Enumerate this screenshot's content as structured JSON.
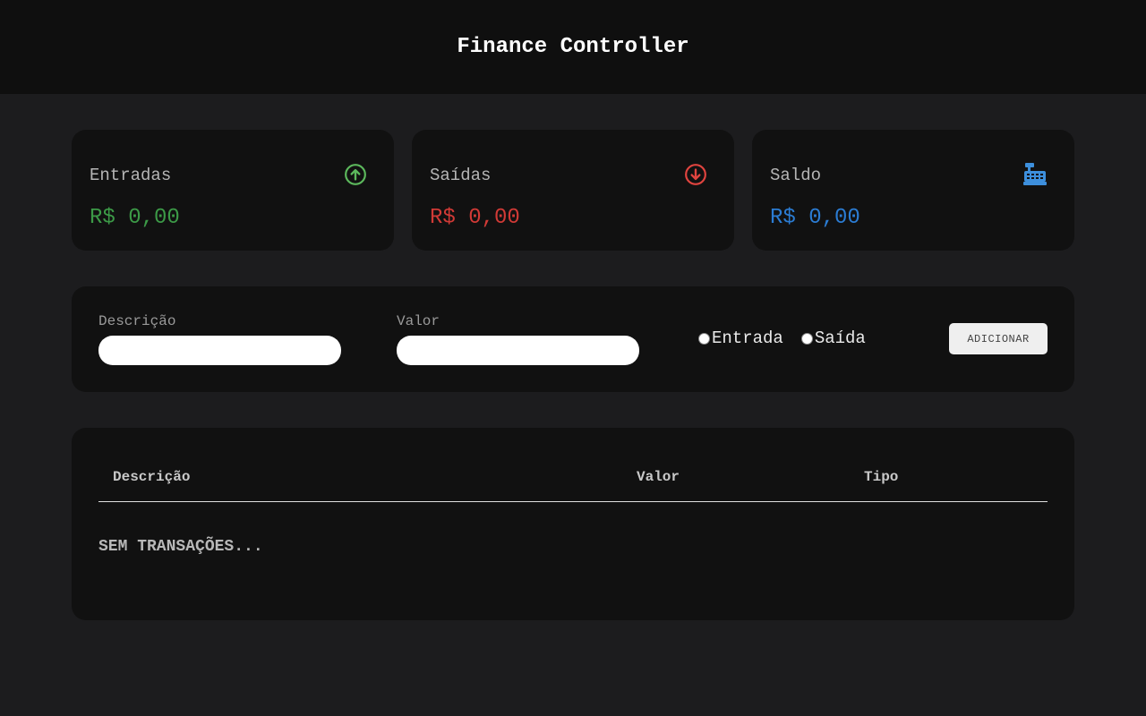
{
  "header": {
    "title": "Finance Controller"
  },
  "summary": {
    "income": {
      "label": "Entradas",
      "value": "R$ 0,00",
      "icon": "arrow-up-circle-icon",
      "color": "#3c9a47"
    },
    "expense": {
      "label": "Saídas",
      "value": "R$ 0,00",
      "icon": "arrow-down-circle-icon",
      "color": "#d13a36"
    },
    "balance": {
      "label": "Saldo",
      "value": "R$ 0,00",
      "icon": "cash-register-icon",
      "color": "#2b7cd3"
    }
  },
  "form": {
    "description_label": "Descrição",
    "description_value": "",
    "amount_label": "Valor",
    "amount_value": "",
    "type_options": [
      "Entrada",
      "Saída"
    ],
    "add_button": "ADICIONAR"
  },
  "table": {
    "headers": [
      "Descrição",
      "Valor",
      "Tipo"
    ],
    "rows": [],
    "empty_message": "SEM TRANSAÇÕES..."
  }
}
